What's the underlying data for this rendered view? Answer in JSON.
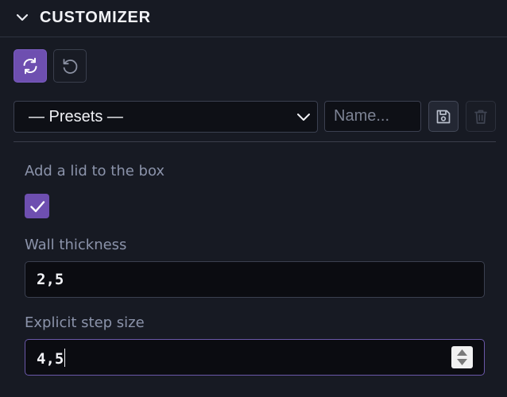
{
  "header": {
    "title": "CUSTOMIZER",
    "collapse_icon": "chevron-down-icon"
  },
  "toolbar": {
    "refresh_icon": "refresh-icon",
    "reset_icon": "reset-icon"
  },
  "presets": {
    "selected": "— Presets —",
    "name_placeholder": "Name...",
    "save_icon": "save-icon",
    "delete_icon": "trash-icon"
  },
  "params": {
    "lid": {
      "label": "Add a lid to the box",
      "checked": true
    },
    "wall": {
      "label": "Wall thickness",
      "value": "2,5"
    },
    "step": {
      "label": "Explicit step size",
      "value": "4,5"
    }
  },
  "colors": {
    "accent": "#6e4fb0",
    "background": "#171a23",
    "label": "#8b93aa"
  }
}
